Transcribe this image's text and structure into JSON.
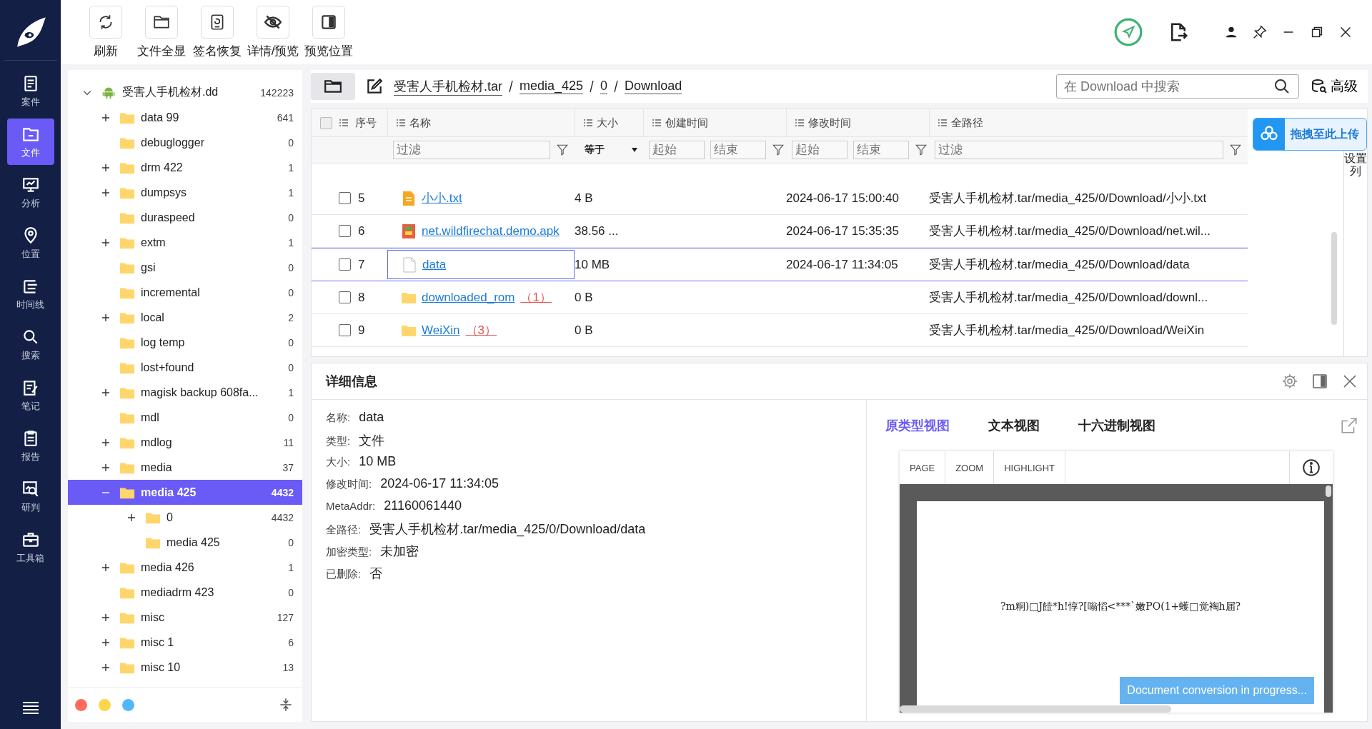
{
  "nav": {
    "items": [
      {
        "label": "案件",
        "selected": false
      },
      {
        "label": "文件",
        "selected": true
      },
      {
        "label": "分析",
        "selected": false
      },
      {
        "label": "位置",
        "selected": false
      },
      {
        "label": "时间线",
        "selected": false
      },
      {
        "label": "搜索",
        "selected": false
      },
      {
        "label": "笔记",
        "selected": false
      },
      {
        "label": "报告",
        "selected": false
      },
      {
        "label": "研判",
        "selected": false
      },
      {
        "label": "工具箱",
        "selected": false
      }
    ]
  },
  "toolbar": [
    {
      "label": "刷新"
    },
    {
      "label": "文件全显"
    },
    {
      "label": "签名恢复"
    },
    {
      "label": "详情/预览"
    },
    {
      "label": "预览位置"
    }
  ],
  "tree": [
    {
      "name": "受害人手机检材.dd",
      "count": "142223",
      "kind": "device",
      "expanded": true,
      "selected": false,
      "children": [
        {
          "name": "data 99",
          "count": "641",
          "kind": "folder",
          "expanded": false,
          "selected": false
        },
        {
          "name": "debuglogger",
          "count": "0",
          "kind": "folder",
          "selected": false
        },
        {
          "name": "drm 422",
          "count": "1",
          "kind": "folder",
          "expanded": false,
          "selected": false
        },
        {
          "name": "dumpsys",
          "count": "1",
          "kind": "folder",
          "expanded": false,
          "selected": false
        },
        {
          "name": "duraspeed",
          "count": "0",
          "kind": "folder",
          "selected": false
        },
        {
          "name": "extm",
          "count": "1",
          "kind": "folder",
          "expanded": false,
          "selected": false
        },
        {
          "name": "gsi",
          "count": "0",
          "kind": "folder",
          "selected": false
        },
        {
          "name": "incremental",
          "count": "0",
          "kind": "folder",
          "selected": false
        },
        {
          "name": "local",
          "count": "2",
          "kind": "folder",
          "expanded": false,
          "selected": false
        },
        {
          "name": "log temp",
          "count": "0",
          "kind": "folder",
          "selected": false
        },
        {
          "name": "lost+found",
          "count": "0",
          "kind": "folder",
          "selected": false
        },
        {
          "name": "magisk backup 608fa...",
          "count": "1",
          "kind": "folder",
          "expanded": false,
          "selected": false
        },
        {
          "name": "mdl",
          "count": "0",
          "kind": "folder",
          "selected": false
        },
        {
          "name": "mdlog",
          "count": "11",
          "kind": "folder",
          "expanded": false,
          "selected": false
        },
        {
          "name": "media",
          "count": "37",
          "kind": "folder",
          "expanded": false,
          "selected": false
        },
        {
          "name": "media 425",
          "count": "4432",
          "kind": "folder",
          "expanded": true,
          "selected": true,
          "children": [
            {
              "name": "0",
              "count": "4432",
              "kind": "folder",
              "expanded": false,
              "selected": false
            },
            {
              "name": "media 425",
              "count": "0",
              "kind": "folder",
              "selected": false
            }
          ]
        },
        {
          "name": "media 426",
          "count": "1",
          "kind": "folder",
          "expanded": false,
          "selected": false
        },
        {
          "name": "mediadrm 423",
          "count": "0",
          "kind": "folder",
          "selected": false
        },
        {
          "name": "misc",
          "count": "127",
          "kind": "folder",
          "expanded": false,
          "selected": false
        },
        {
          "name": "misc 1",
          "count": "6",
          "kind": "folder",
          "expanded": false,
          "selected": false
        },
        {
          "name": "misc 10",
          "count": "13",
          "kind": "folder",
          "expanded": false,
          "selected": false
        }
      ]
    }
  ],
  "tree_footer": {
    "dots": [
      {
        "color": "#ff6b5e"
      },
      {
        "color": "#ffd54a"
      },
      {
        "color": "#4fb8ff"
      }
    ]
  },
  "breadcrumb": [
    "受害人手机检材.tar",
    "media_425",
    "0",
    "Download"
  ],
  "search": {
    "placeholder": "在 Download 中搜索"
  },
  "advanced_label": "高级",
  "upload_label": "拖拽至此上传",
  "column_settings_label": "设置列",
  "table": {
    "columns": [
      "序号",
      "名称",
      "大小",
      "创建时间",
      "修改时间",
      "全路径"
    ],
    "all_checked": false,
    "filters": {
      "name_placeholder": "过滤",
      "size_op": "等于",
      "created_start_placeholder": "起始",
      "created_end_placeholder": "结束",
      "modified_start_placeholder": "起始",
      "modified_end_placeholder": "结束",
      "path_placeholder": "过滤"
    },
    "rows": [
      {
        "no": "5",
        "name": "小小.txt",
        "kind": "txt",
        "size": "4 B",
        "modified": "2024-06-17 15:00:40",
        "path": "受害人手机检材.tar/media_425/0/Download/小小.txt",
        "checked": false,
        "selected": false
      },
      {
        "no": "6",
        "name": "net.wildfirechat.demo.apk",
        "kind": "apk",
        "size": "38.56 ...",
        "modified": "2024-06-17 15:35:35",
        "path": "受害人手机检材.tar/media_425/0/Download/net.wil...",
        "checked": false,
        "selected": false
      },
      {
        "no": "7",
        "name": "data",
        "kind": "file",
        "size": "10 MB",
        "modified": "2024-06-17 11:34:05",
        "path": "受害人手机检材.tar/media_425/0/Download/data",
        "checked": false,
        "selected": true
      },
      {
        "no": "8",
        "name": "downloaded_rom",
        "kind": "folder",
        "count": "（1）",
        "size": "0 B",
        "path": "受害人手机检材.tar/media_425/0/Download/downl...",
        "checked": false,
        "selected": false
      },
      {
        "no": "9",
        "name": "WeiXin",
        "kind": "folder",
        "count": "（3）",
        "size": "0 B",
        "path": "受害人手机检材.tar/media_425/0/Download/WeiXin",
        "checked": false,
        "selected": false
      }
    ]
  },
  "details": {
    "title": "详细信息",
    "fields": [
      {
        "label": "名称:",
        "value": "data"
      },
      {
        "label": "类型:",
        "value": "文件"
      },
      {
        "label": "大小:",
        "value": "10 MB"
      },
      {
        "label": "修改时间:",
        "value": "2024-06-17 11:34:05"
      },
      {
        "label": "MetaAddr:",
        "value": "21160061440"
      },
      {
        "label": "全路径:",
        "value": "受害人手机检材.tar/media_425/0/Download/data"
      },
      {
        "label": "加密类型:",
        "value": "未加密"
      },
      {
        "label": "已删除:",
        "value": "否"
      }
    ]
  },
  "preview": {
    "tabs": [
      {
        "label": "原类型视图",
        "selected": true
      },
      {
        "label": "文本视图",
        "selected": false
      },
      {
        "label": "十六进制视图",
        "selected": false
      }
    ],
    "viewer_buttons": [
      "PAGE",
      "ZOOM",
      "HIGHLIGHT"
    ],
    "document_text": "?m粡)□J饐*h!惇?[嗡慆<***`嫩PO(1+蠖□觉裪h届?",
    "toast": "Document conversion in progress..."
  }
}
